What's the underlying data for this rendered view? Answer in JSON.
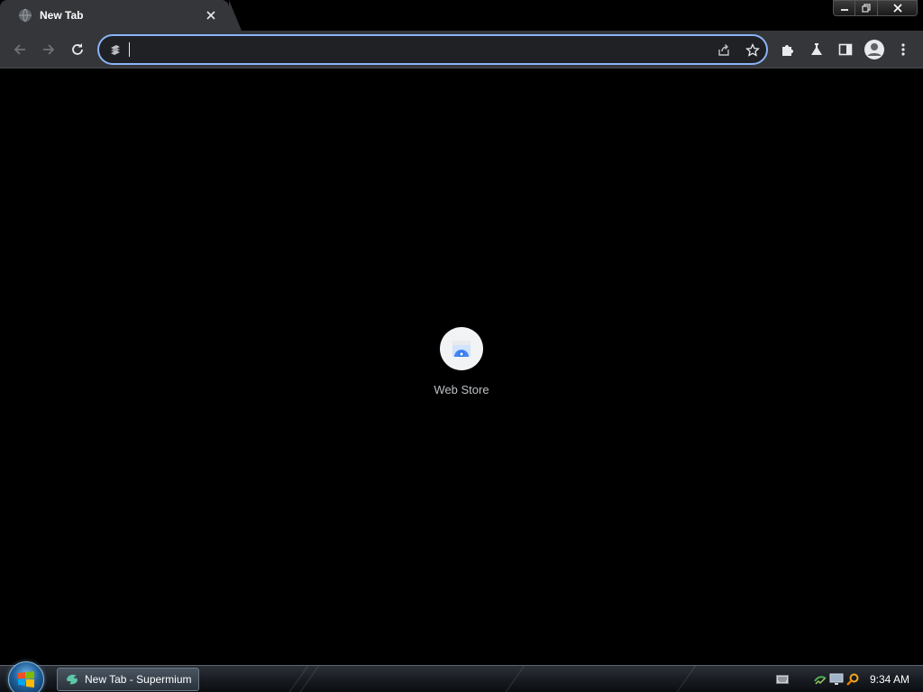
{
  "window": {
    "tab_title": "New Tab",
    "controls": {
      "minimize": "minimize-icon",
      "restore": "restore-icon",
      "close": "close-icon"
    }
  },
  "toolbar": {
    "omnibox": {
      "value": "",
      "placeholder": ""
    },
    "icons": [
      "back-arrow-icon",
      "forward-arrow-icon",
      "reload-icon",
      "share-icon",
      "bookmark-star-icon",
      "extensions-puzzle-icon",
      "labs-flask-icon",
      "side-panel-icon",
      "profile-avatar-icon",
      "menu-kebab-icon"
    ]
  },
  "new_tab": {
    "shortcuts": [
      {
        "label": "Web Store",
        "icon": "web-store-icon"
      }
    ]
  },
  "taskbar": {
    "start": "windows-start-orb",
    "buttons": [
      {
        "label": "New Tab - Supermium",
        "icon": "supermium-icon"
      }
    ],
    "tray_icons": [
      "keyboard-icon",
      "network-icon",
      "display-icon",
      "search-icon"
    ],
    "clock": "9:34 AM"
  },
  "colors": {
    "background": "#000000",
    "toolbar": "#35363a",
    "omnibox_border": "#8ab4f8",
    "omnibox_fill": "#202124"
  }
}
